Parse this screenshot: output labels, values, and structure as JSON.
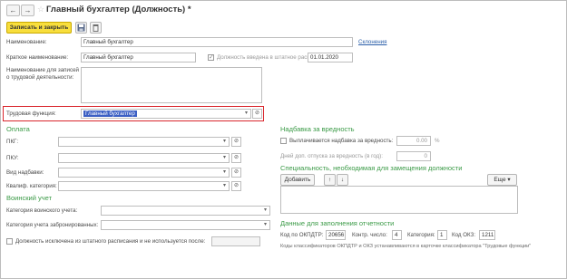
{
  "window": {
    "title": "Главный бухгалтер (Должность) *"
  },
  "toolbar": {
    "save_close_label": "Записать и закрыть"
  },
  "fields": {
    "name_label": "Наименование:",
    "name_value": "Главный бухгалтер",
    "declensions_link": "Склонения",
    "short_name_label": "Краткое наименование:",
    "short_name_value": "Главный бухгалтер",
    "staffing_label": "Должность введена в штатное расписание:",
    "staffing_date": "01.01.2020",
    "workbook_label": "Наименование для записей о трудовой деятельности:",
    "labor_function_label": "Трудовая функция:",
    "labor_function_value": "Главный бухгалтер"
  },
  "payment": {
    "title": "Оплата",
    "pkg_label": "ПКГ:",
    "pku_label": "ПКУ:",
    "allowance_type_label": "Вид надбавки:",
    "qual_category_label": "Квалиф. категория:"
  },
  "military": {
    "title": "Воинский учет",
    "category_label": "Категория воинского учета:",
    "reserved_label": "Категория учета забронированных:"
  },
  "excluded": {
    "label": "Должность исключена из штатного расписания и не используется после:"
  },
  "hazard": {
    "title": "Надбавка за вредность",
    "paid_label": "Выплачивается надбавка за вредность:",
    "paid_value": "0.00",
    "percent_sign": "%",
    "extra_leave_label": "Дней доп. отпуска за вредность (в год):",
    "extra_leave_value": "0"
  },
  "specialty": {
    "title": "Специальность, необходимая для замещения должности",
    "add_label": "Добавить",
    "more_label": "Еще"
  },
  "reporting": {
    "title": "Данные для заполнения отчетности",
    "okpdtr_label": "Код по ОКПДТР:",
    "okpdtr_value": "20656",
    "control_label": "Контр. число:",
    "control_value": "4",
    "category_label": "Категория:",
    "category_value": "1",
    "okz_label": "Код ОКЗ:",
    "okz_value": "1211",
    "note": "Коды классификаторов ОКПДТР и ОКЗ устанавливаются в карточке классификатора \"Трудовые функции\""
  },
  "icons": {
    "back": "back-arrow-icon",
    "forward": "forward-arrow-icon",
    "star": "favorite-star-icon",
    "save": "save-disk-icon",
    "delete": "delete-trash-icon",
    "dropdown": "chevron-down-icon",
    "open": "open-link-icon",
    "up": "arrow-up-icon",
    "down": "arrow-down-icon"
  },
  "colors": {
    "accent_button": "#f8de3c",
    "section_title": "#3a9a46",
    "highlight_border": "#d9262c",
    "selection": "#3c5fc4",
    "link": "#2a5ea8"
  }
}
